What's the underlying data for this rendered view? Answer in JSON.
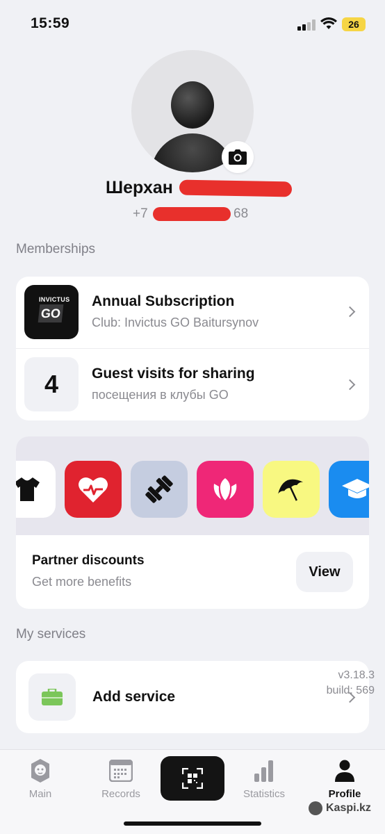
{
  "status_bar": {
    "time": "15:59",
    "battery": "26"
  },
  "profile": {
    "name": "Шерхан",
    "phone_prefix": "+7",
    "phone_suffix": "68"
  },
  "memberships": {
    "title": "Memberships",
    "items": [
      {
        "title": "Annual Subscription",
        "subtitle": "Club: Invictus GO Baitursynov",
        "logo_small": "INVICTUS",
        "logo_main": "GO"
      },
      {
        "title": "Guest visits for sharing",
        "subtitle": "посещения в клубы GO",
        "count": "4"
      }
    ]
  },
  "partners": {
    "title": "Partner discounts",
    "subtitle": "Get more benefits",
    "view_label": "View",
    "icons": [
      {
        "name": "tshirt-icon",
        "color": "#ffffff"
      },
      {
        "name": "heart-pulse-icon",
        "color": "#e0232f"
      },
      {
        "name": "dumbbell-icon",
        "color": "#c5cde0"
      },
      {
        "name": "flower-icon",
        "color": "#ef2777"
      },
      {
        "name": "umbrella-icon",
        "color": "#f8f881"
      },
      {
        "name": "graduation-cap-icon",
        "color": "#1a8cf0"
      }
    ]
  },
  "services": {
    "title": "My services",
    "add_label": "Add service",
    "version": "v3.18.3",
    "build": "build: 569"
  },
  "tabs": [
    {
      "label": "Main"
    },
    {
      "label": "Records"
    },
    {
      "label": "Statistics"
    },
    {
      "label": "Profile"
    }
  ],
  "watermark": "Kaspi.kz"
}
